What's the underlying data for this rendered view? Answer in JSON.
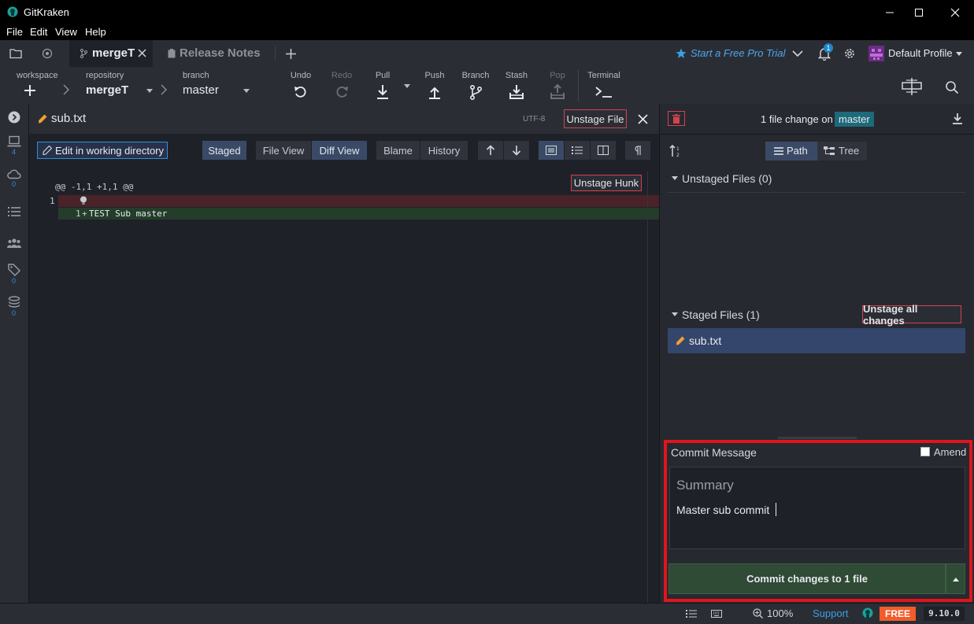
{
  "window": {
    "title": "GitKraken"
  },
  "menu": [
    "File",
    "Edit",
    "View",
    "Help"
  ],
  "tabs": [
    {
      "label": "mergeT",
      "active": true
    },
    {
      "label": "Release Notes",
      "active": false
    }
  ],
  "header_right": {
    "trial": "Start a Free Pro Trial",
    "notifications_count": "1",
    "profile": "Default Profile"
  },
  "toolbar": {
    "workspace_label": "workspace",
    "repository_label": "repository",
    "repository_value": "mergeT",
    "branch_label": "branch",
    "branch_value": "master",
    "undo": "Undo",
    "redo": "Redo",
    "pull": "Pull",
    "push": "Push",
    "branch_btn": "Branch",
    "stash": "Stash",
    "pop": "Pop",
    "terminal": "Terminal"
  },
  "left_rail": {
    "local_count": "4",
    "remote_count": "0",
    "tags_count": "0",
    "submodules_count": "0"
  },
  "diff": {
    "filename": "sub.txt",
    "encoding": "UTF-8",
    "unstage_file": "Unstage File",
    "edit_in_wd": "Edit in working directory",
    "staged": "Staged",
    "file_view": "File View",
    "diff_view": "Diff View",
    "blame": "Blame",
    "history": "History",
    "hunk_header": "@@ -1,1 +1,1 @@",
    "unstage_hunk": "Unstage Hunk",
    "removed_line_no": "1",
    "added_line_no": "1",
    "added_marker": "+",
    "added_text": "TEST Sub master"
  },
  "right": {
    "change_summary": "1 file change on",
    "branch": "master",
    "path": "Path",
    "tree": "Tree",
    "unstaged_header": "Unstaged Files (0)",
    "staged_header": "Staged Files (1)",
    "unstage_all": "Unstage all changes",
    "staged_file": "sub.txt",
    "commit_message_label": "Commit Message",
    "amend": "Amend",
    "summary_placeholder": "Summary",
    "summary_value": "Master sub commit",
    "commit_button": "Commit changes to 1 file"
  },
  "status": {
    "zoom": "100%",
    "support": "Support",
    "plan": "FREE",
    "version": "9.10.0"
  },
  "colors": {
    "accent": "#1e86c8",
    "highlight_red": "#e0141e",
    "removed_bg": "#4a2328",
    "added_bg": "#233d2a",
    "commit_green": "#2f4a35",
    "branch_badge": "#1c6a7a"
  }
}
